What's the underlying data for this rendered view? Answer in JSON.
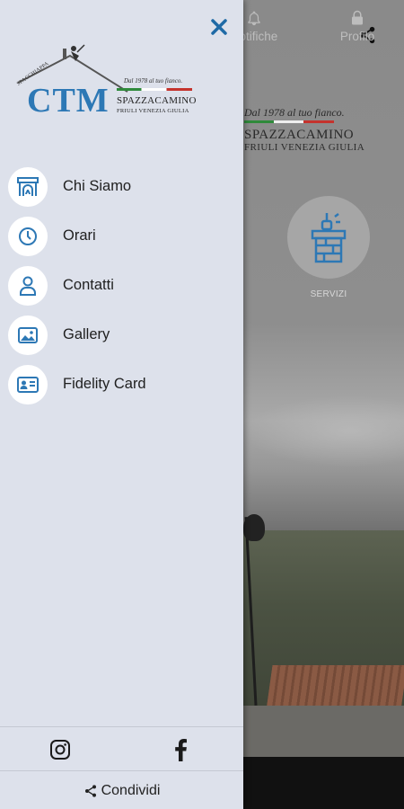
{
  "background": {
    "logo_tagline": "Dal 1978 al tuo fianco.",
    "logo_company": "SPAZZACAMINO",
    "logo_region": "FRIULI VENEZIA GIULIA",
    "services_label": "SERVIZI",
    "tabs": [
      {
        "label": "Notifiche",
        "icon": "bell-icon"
      },
      {
        "label": "Profilo",
        "icon": "lock-icon"
      }
    ]
  },
  "drawer": {
    "logo": {
      "brand": "CTM",
      "small_text": "SPACCHIAPPA",
      "tagline": "Dal 1978 al tuo fianco.",
      "company": "SPAZZACAMINO",
      "region": "FRIULI VENEZIA GIULIA"
    },
    "menu": [
      {
        "label": "Chi Siamo",
        "icon": "fireplace-icon"
      },
      {
        "label": "Orari",
        "icon": "clock-icon"
      },
      {
        "label": "Contatti",
        "icon": "person-icon"
      },
      {
        "label": "Gallery",
        "icon": "image-icon"
      },
      {
        "label": "Fidelity Card",
        "icon": "id-card-icon"
      }
    ],
    "social": [
      "instagram-icon",
      "facebook-icon"
    ],
    "share_label": "Condividi"
  },
  "colors": {
    "drawer_bg": "#dde1eb",
    "accent": "#2d78b5",
    "close_icon": "#1f6aa6"
  }
}
